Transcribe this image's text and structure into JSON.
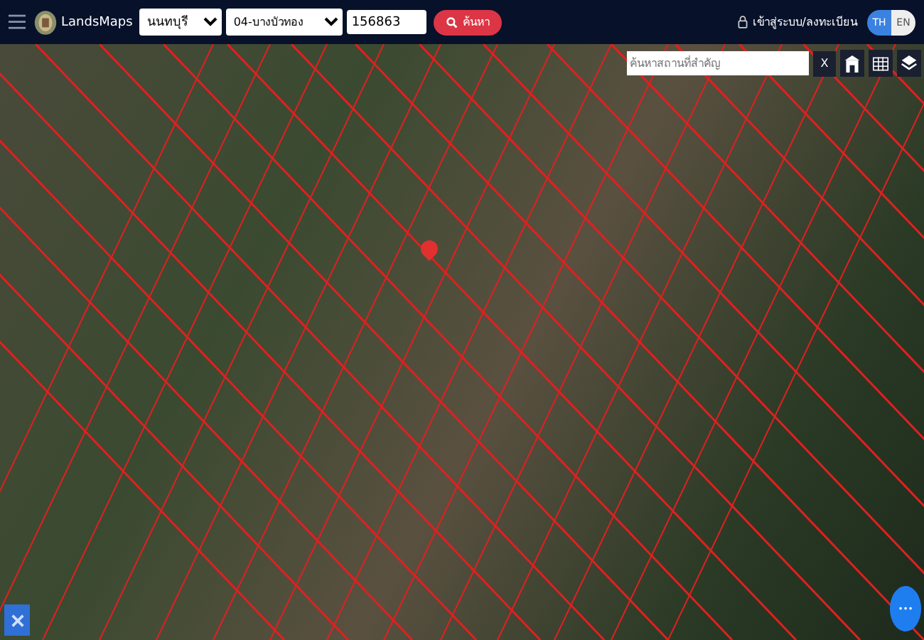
{
  "header": {
    "brand": "LandsMaps",
    "province": "นนทบุรี",
    "district": "04-บางบัวทอง",
    "parcel_number": "156863",
    "search_button": "ค้นหา",
    "login": "เข้าสู่ระบบ/ลงทะเบียน",
    "languages": [
      {
        "label": "TH",
        "selected": true
      },
      {
        "label": "EN",
        "selected": false
      }
    ]
  },
  "map": {
    "place_search": {
      "placeholder": "ค้นหาสถานที่สำคัญ"
    },
    "clear_button": "X",
    "fab_label": "•••"
  }
}
